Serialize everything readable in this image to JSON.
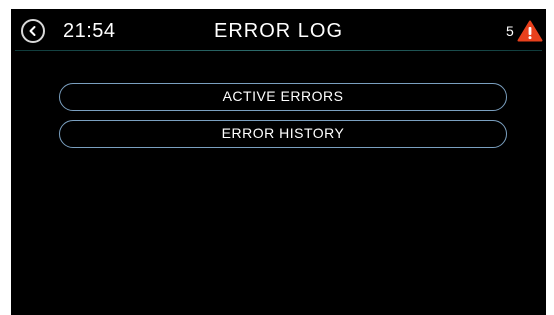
{
  "header": {
    "time": "21:54",
    "title": "ERROR LOG",
    "alert_count": "5",
    "back_icon": "chevron-left-circle",
    "alert_icon": "warning-triangle",
    "alert_color": "#e8401c"
  },
  "menu": {
    "items": [
      {
        "label": "ACTIVE ERRORS"
      },
      {
        "label": "ERROR HISTORY"
      }
    ]
  },
  "colors": {
    "background": "#000000",
    "text": "#ffffff",
    "button_border": "#7a9fbf"
  }
}
